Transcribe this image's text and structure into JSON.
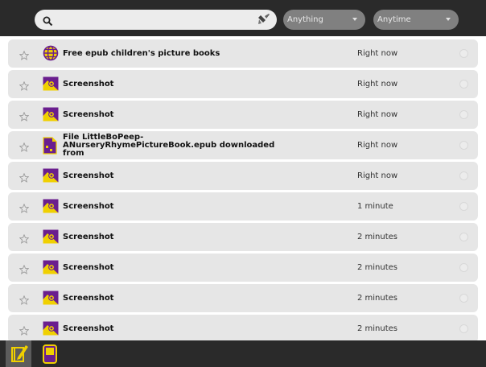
{
  "search": {
    "value": "",
    "placeholder": ""
  },
  "filters": {
    "what": "Anything",
    "when": "Anytime"
  },
  "entries": [
    {
      "title": "Free epub children's picture books",
      "time": "Right now",
      "icon": "browse-globe-icon"
    },
    {
      "title": "Screenshot",
      "time": "Right now",
      "icon": "image-icon"
    },
    {
      "title": "Screenshot",
      "time": "Right now",
      "icon": "image-icon"
    },
    {
      "title": "File LittleBoPeep-ANurseryRhymePictureBook.epub downloaded from",
      "time": "Right now",
      "icon": "document-icon"
    },
    {
      "title": "Screenshot",
      "time": "Right now",
      "icon": "image-icon"
    },
    {
      "title": "Screenshot",
      "time": "1 minute",
      "icon": "image-icon"
    },
    {
      "title": "Screenshot",
      "time": "2 minutes",
      "icon": "image-icon"
    },
    {
      "title": "Screenshot",
      "time": "2 minutes",
      "icon": "image-icon"
    },
    {
      "title": "Screenshot",
      "time": "2 minutes",
      "icon": "image-icon"
    },
    {
      "title": "Screenshot",
      "time": "2 minutes",
      "icon": "image-icon"
    }
  ],
  "bottom_tabs": [
    {
      "icon": "journal-icon",
      "active": true
    },
    {
      "icon": "volumes-icon",
      "active": false
    }
  ],
  "colors": {
    "accent_yellow": "#f0d000",
    "accent_purple": "#6a1e8e",
    "toolbar": "#2a2a2a",
    "row": "#e6e6e6"
  }
}
